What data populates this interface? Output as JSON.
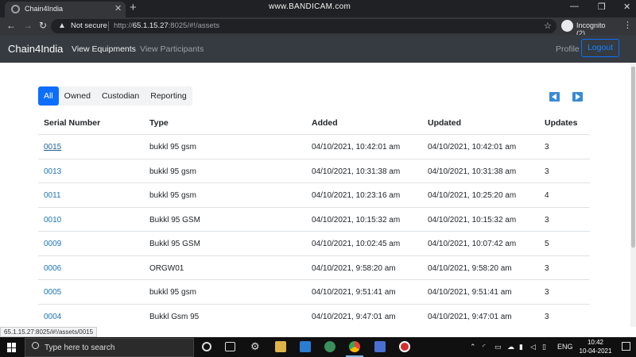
{
  "browser": {
    "tab_title": "Chain4India",
    "watermark": "www.BANDICAM.com",
    "security_label": "Not secure",
    "url_prefix": "http://",
    "url_host": "65.1.15.27",
    "url_rest": ":8025/#!/assets",
    "profile_label": "Incognito (2)",
    "status_url": "65.1.15.27:8025/#!/assets/0015"
  },
  "navbar": {
    "brand": "Chain4India",
    "links": [
      "View Equipments",
      "View Participants"
    ],
    "profile": "Profile",
    "logout": "Logout"
  },
  "filters": [
    "All",
    "Owned",
    "Custodian",
    "Reporting"
  ],
  "active_filter": "All",
  "table": {
    "headers": [
      "Serial Number",
      "Type",
      "Added",
      "Updated",
      "Updates"
    ],
    "rows": [
      {
        "serial": "0015",
        "type": "bukkl 95 gsm",
        "added": "04/10/2021, 10:42:01 am",
        "updated": "04/10/2021, 10:42:01 am",
        "updates": "3"
      },
      {
        "serial": "0013",
        "type": "bukkl 95 gsm",
        "added": "04/10/2021, 10:31:38 am",
        "updated": "04/10/2021, 10:31:38 am",
        "updates": "3"
      },
      {
        "serial": "0011",
        "type": "bukkl 95 gsm",
        "added": "04/10/2021, 10:23:16 am",
        "updated": "04/10/2021, 10:25:20 am",
        "updates": "4"
      },
      {
        "serial": "0010",
        "type": "Bukkl 95 GSM",
        "added": "04/10/2021, 10:15:32 am",
        "updated": "04/10/2021, 10:15:32 am",
        "updates": "3"
      },
      {
        "serial": "0009",
        "type": "Bukkl 95 GSM",
        "added": "04/10/2021, 10:02:45 am",
        "updated": "04/10/2021, 10:07:42 am",
        "updates": "5"
      },
      {
        "serial": "0006",
        "type": "ORGW01",
        "added": "04/10/2021, 9:58:20 am",
        "updated": "04/10/2021, 9:58:20 am",
        "updates": "3"
      },
      {
        "serial": "0005",
        "type": "bukkl 95 gsm",
        "added": "04/10/2021, 9:51:41 am",
        "updated": "04/10/2021, 9:51:41 am",
        "updates": "3"
      },
      {
        "serial": "0004",
        "type": "Bukkl Gsm 95",
        "added": "04/10/2021, 9:47:01 am",
        "updated": "04/10/2021, 9:47:01 am",
        "updates": "3"
      }
    ]
  },
  "taskbar": {
    "search_placeholder": "Type here to search",
    "language": "ENG",
    "time": "10:42",
    "date": "10-04-2021"
  },
  "colors": {
    "navbar_bg": "#353b41",
    "primary": "#0d6efd",
    "link": "#1a73b8"
  }
}
